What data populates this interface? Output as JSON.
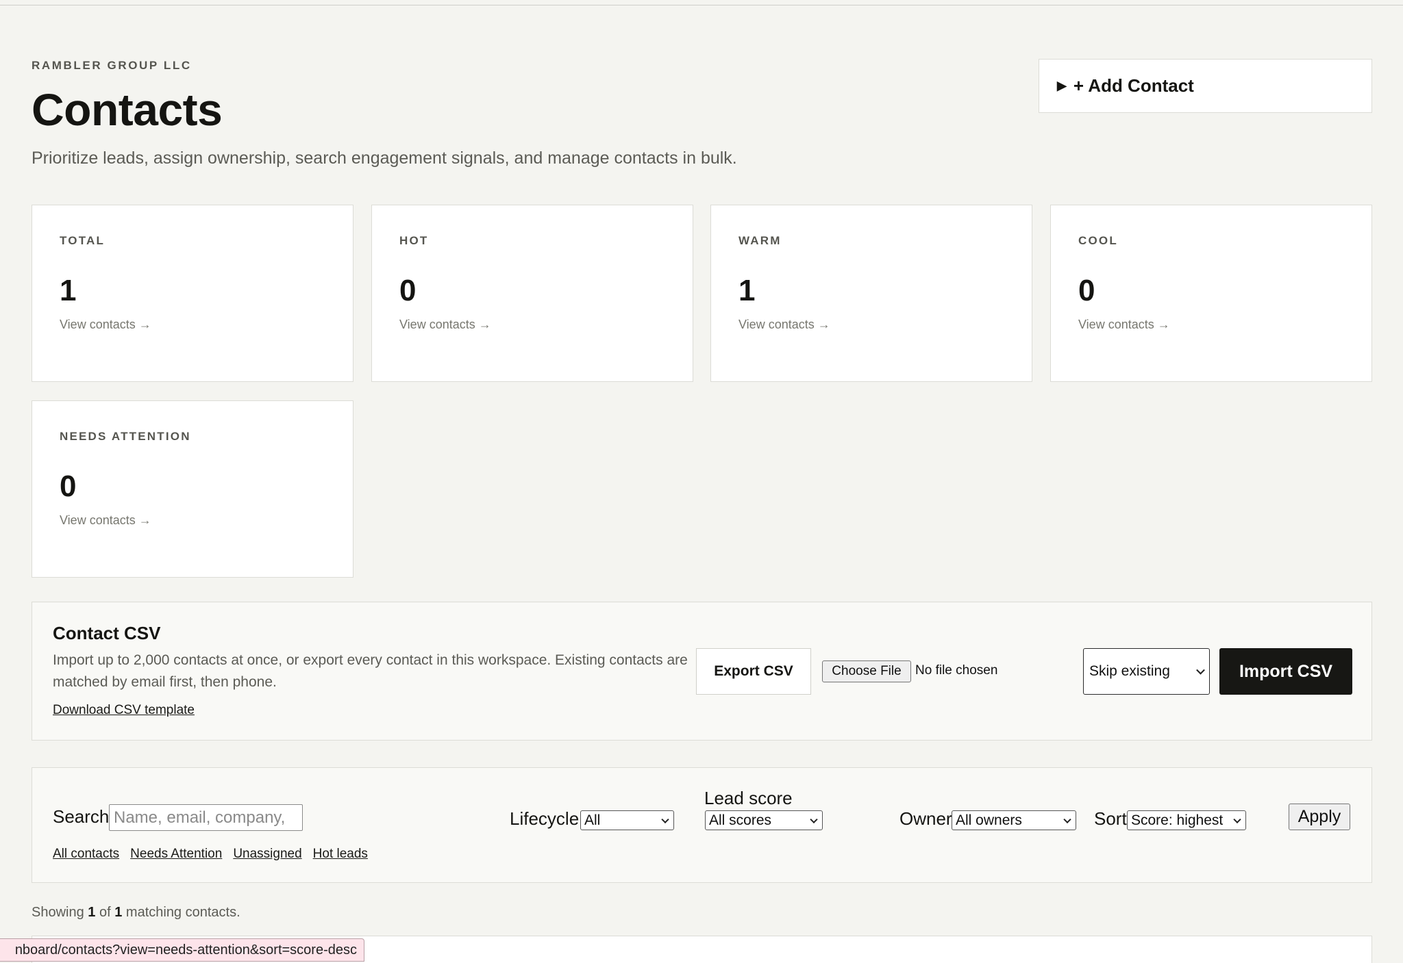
{
  "header": {
    "eyebrow": "RAMBLER GROUP LLC",
    "title": "Contacts",
    "subtitle": "Prioritize leads, assign ownership, search engagement signals, and manage contacts in bulk.",
    "add_contact_label": "+ Add Contact",
    "add_contact_marker": "▶"
  },
  "stats": [
    {
      "label": "TOTAL",
      "count": "1",
      "link": "View contacts →"
    },
    {
      "label": "HOT",
      "count": "0",
      "link": "View contacts →"
    },
    {
      "label": "WARM",
      "count": "1",
      "link": "View contacts →"
    },
    {
      "label": "COOL",
      "count": "0",
      "link": "View contacts →"
    },
    {
      "label": "NEEDS ATTENTION",
      "count": "0",
      "link": "View contacts →"
    }
  ],
  "csv": {
    "title": "Contact CSV",
    "description": "Import up to 2,000 contacts at once, or export every contact in this workspace. Existing contacts are matched by email first, then phone.",
    "template_link": "Download CSV template",
    "export_label": "Export CSV",
    "choose_file_label": "Choose File",
    "file_status": "No file chosen",
    "duplicate_mode": "Skip existing",
    "import_label": "Import CSV"
  },
  "filters": {
    "search_label": "Search",
    "search_placeholder": "Name, email, company,",
    "lifecycle_label": "Lifecycle",
    "lifecycle_value": "All",
    "lead_score_label": "Lead score",
    "lead_score_value": "All scores",
    "owner_label": "Owner",
    "owner_value": "All owners",
    "sort_label": "Sort",
    "sort_value": "Score: highest",
    "apply_label": "Apply",
    "quick_links": [
      "All contacts",
      "Needs Attention",
      "Unassigned",
      "Hot leads"
    ]
  },
  "results": {
    "prefix": "Showing",
    "shown": "1",
    "of": "of",
    "total": "1",
    "suffix": "matching contacts."
  },
  "status_bar": {
    "url": "nboard/contacts?view=needs-attention&sort=score-desc"
  }
}
